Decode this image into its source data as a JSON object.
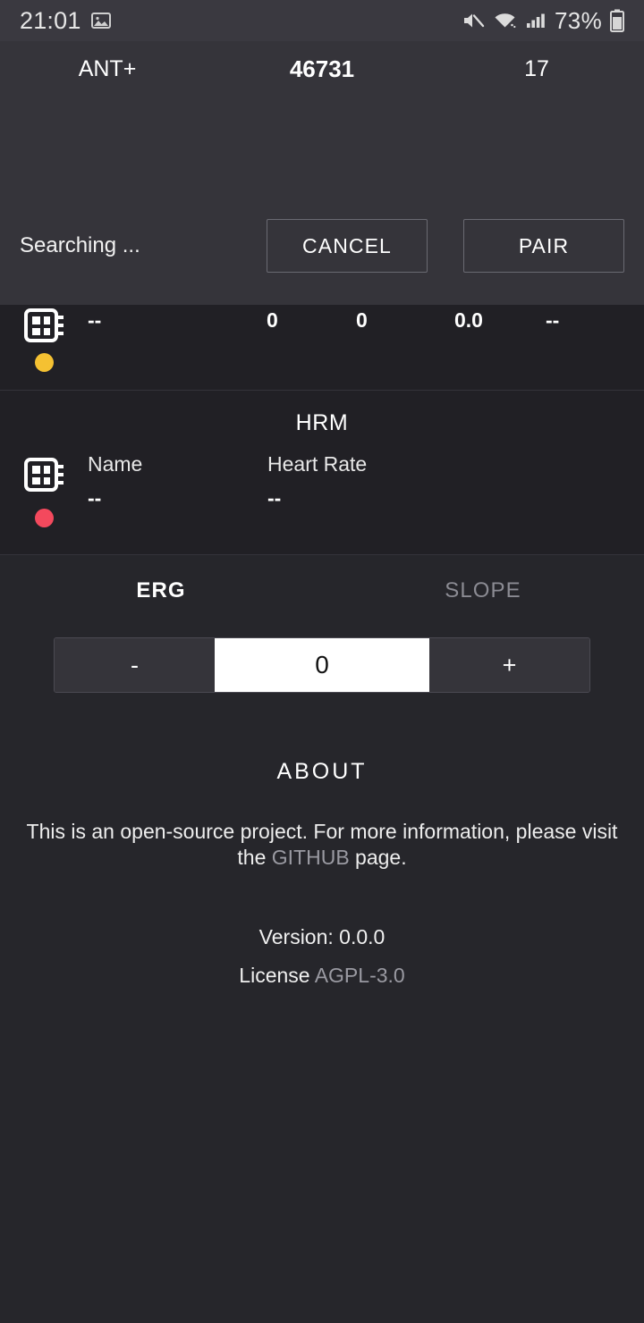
{
  "status_bar": {
    "clock": "21:01",
    "battery_percent": "73%",
    "icons": [
      "image-icon",
      "mute-icon",
      "wifi-icon",
      "signal-icon",
      "battery-icon"
    ]
  },
  "app_bar": {
    "protocol": "ANT+",
    "device_id": "46731",
    "counter": "17"
  },
  "pair_dialog": {
    "status": "Searching ...",
    "cancel_label": "CANCEL",
    "pair_label": "PAIR"
  },
  "clipped_device": {
    "status_color": "#f5c132",
    "values": [
      "--",
      "0",
      "0",
      "0.0",
      "--"
    ]
  },
  "hrm": {
    "title": "HRM",
    "status_color": "#f4495d",
    "columns": [
      {
        "label": "Name",
        "value": "--"
      },
      {
        "label": "Heart Rate",
        "value": "--"
      }
    ]
  },
  "modes": {
    "erg_label": "ERG",
    "slope_label": "SLOPE",
    "active": "ERG"
  },
  "stepper": {
    "minus_label": "-",
    "value": "0",
    "plus_label": "+"
  },
  "about": {
    "title": "ABOUT",
    "text_before": "This is an open-source project. For more information, please visit the ",
    "link_label": "GITHUB",
    "text_after": " page.",
    "version": "Version: 0.0.0",
    "license_label": "License ",
    "license_value": "AGPL-3.0"
  }
}
